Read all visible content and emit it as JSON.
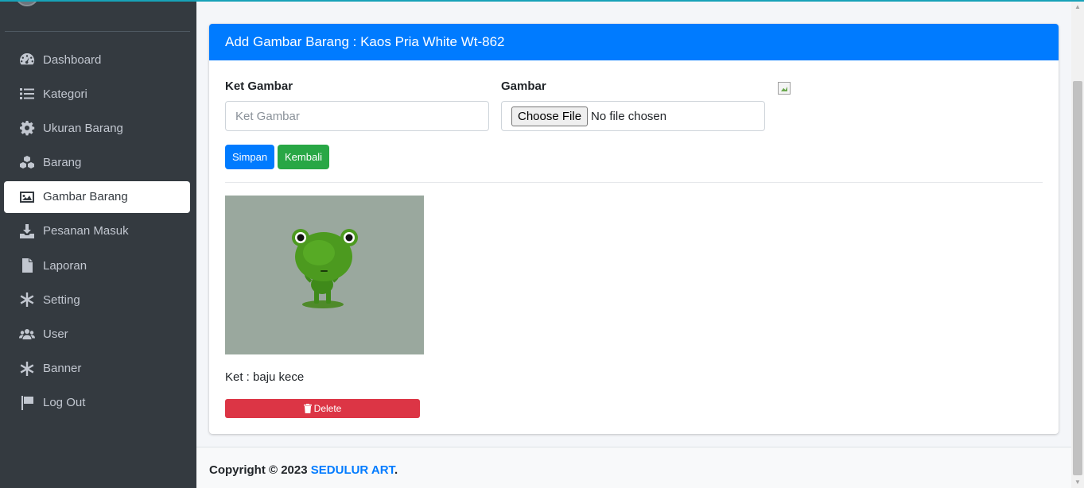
{
  "sidebar": {
    "items": [
      {
        "label": "Dashboard",
        "icon": "dashboard-icon",
        "active": false
      },
      {
        "label": "Kategori",
        "icon": "list-icon",
        "active": false
      },
      {
        "label": "Ukuran Barang",
        "icon": "gear-icon",
        "active": false
      },
      {
        "label": "Barang",
        "icon": "cubes-icon",
        "active": false
      },
      {
        "label": "Gambar Barang",
        "icon": "image-icon",
        "active": true
      },
      {
        "label": "Pesanan Masuk",
        "icon": "download-icon",
        "active": false
      },
      {
        "label": "Laporan",
        "icon": "file-icon",
        "active": false
      },
      {
        "label": "Setting",
        "icon": "asterisk-icon",
        "active": false
      },
      {
        "label": "User",
        "icon": "users-icon",
        "active": false
      },
      {
        "label": "Banner",
        "icon": "asterisk-icon",
        "active": false
      },
      {
        "label": "Log Out",
        "icon": "flag-icon",
        "active": false
      }
    ]
  },
  "card": {
    "title": "Add Gambar Barang : Kaos Pria White Wt-862"
  },
  "form": {
    "ket_label": "Ket Gambar",
    "ket_placeholder": "Ket Gambar",
    "gambar_label": "Gambar",
    "file_button": "Choose File",
    "file_status": "No file chosen",
    "save_label": "Simpan",
    "back_label": "Kembali"
  },
  "gallery": {
    "items": [
      {
        "ket": "Ket : baju kece",
        "delete_label": "Delete"
      }
    ]
  },
  "footer": {
    "copyright": "Copyright © 2023",
    "brand": "SEDULUR ART",
    "suffix": "."
  },
  "colors": {
    "sidebar_bg": "#343a40",
    "primary": "#007bff",
    "success": "#28a745",
    "danger": "#dc3545"
  }
}
